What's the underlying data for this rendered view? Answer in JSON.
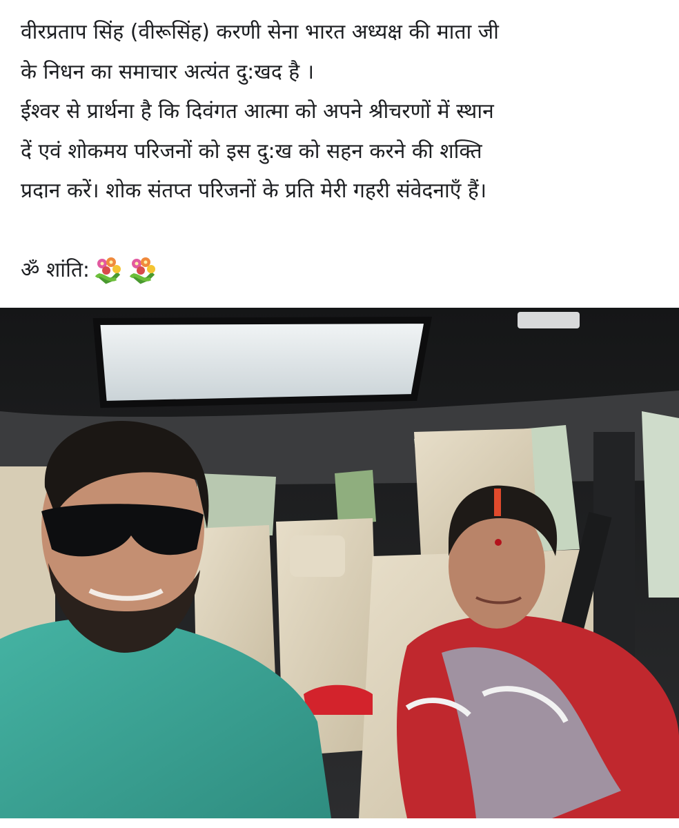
{
  "post": {
    "lines": [
      "वीरप्रताप सिंह (वीरूसिंह) करणी सेना भारत अध्यक्ष की माता जी",
      "के निधन का समाचार अत्यंत दु:खद है ।",
      "ईश्वर से प्रार्थना है कि दिवंगत आत्मा को अपने श्रीचरणों में स्थान",
      "दें एवं शोकमय परिजनों को इस दु:ख को सहन करने की शक्ति",
      "प्रदान करें। शोक संतप्त परिजनों के प्रति मेरी गहरी संवेदनाएँ हैं।"
    ],
    "closing": "ॐ शांति:",
    "closing_emoji": [
      "bouquet-icon",
      "bouquet-icon"
    ]
  },
  "photo": {
    "subject": "car-selfie",
    "colors": {
      "shirt": "#3aa596",
      "saree_red": "#c0282e",
      "seat_beige": "#d9cfb8",
      "roof": "#1f2021"
    }
  }
}
